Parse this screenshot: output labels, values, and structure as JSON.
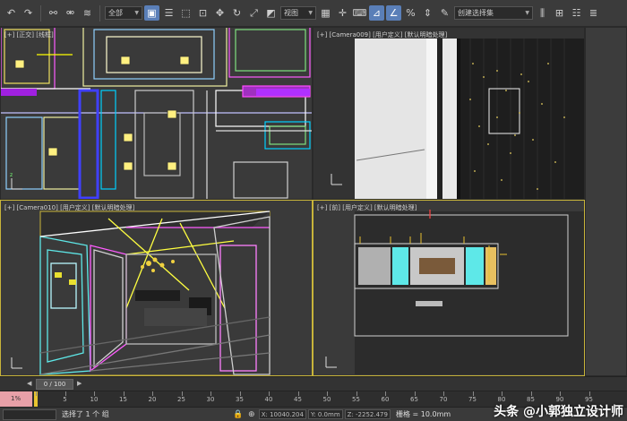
{
  "toolbar": {
    "layer_dropdown": "全部",
    "view_dropdown": "视图",
    "selection_set": "创建选择集",
    "icons": [
      "undo-icon",
      "redo-icon",
      "link-icon",
      "unlink-icon",
      "bind-spacewarp-icon",
      "select-icon",
      "select-by-name-icon",
      "rect-select-icon",
      "window-crossing-icon",
      "move-icon",
      "rotate-icon",
      "scale-icon",
      "placement-icon",
      "ref-coord-icon",
      "pivot-icon",
      "select-manipulate-icon",
      "keyboard-shortcut-icon",
      "snap-icon",
      "angle-snap-icon",
      "percent-snap-icon",
      "spinner-snap-icon",
      "edit-named-sel-icon",
      "mirror-icon",
      "align-icon"
    ]
  },
  "viewports": {
    "top_left": {
      "label": "[+] [正交] [线框]"
    },
    "top_right": {
      "label": "[+] [Camera009] [用户定义] [默认明暗处理]"
    },
    "bottom_left": {
      "label": "[+] [Camera010] [用户定义] [默认明暗处理]"
    },
    "bottom_right": {
      "label": "[+] [前] [用户定义] [默认明暗处理]"
    }
  },
  "timeline": {
    "frame_display": "0 / 100",
    "ticks": [
      "0",
      "5",
      "10",
      "15",
      "20",
      "25",
      "30",
      "35",
      "40",
      "45",
      "50",
      "55",
      "60",
      "65",
      "70",
      "75",
      "80",
      "85",
      "90",
      "95"
    ],
    "left_label": "1%"
  },
  "status": {
    "message": "选择了 1 个 组",
    "x_field": "X: 10040.204",
    "y_field": "Y: 0.0mm",
    "z_field": "Z: -2252.479",
    "grid": "栅格 = 10.0mm"
  },
  "watermark": "头条 @小郭独立设计师"
}
